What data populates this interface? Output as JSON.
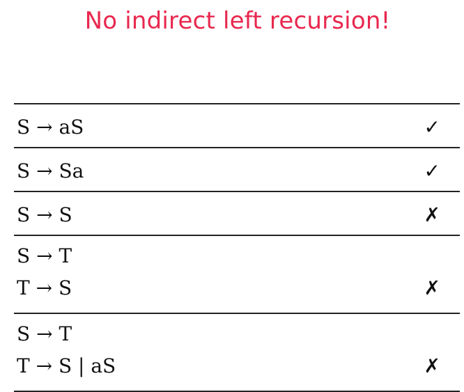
{
  "title": "No indirect left recursion!",
  "rows": [
    {
      "lines": [
        "S → aS"
      ],
      "mark": "✓"
    },
    {
      "lines": [
        "S → Sa"
      ],
      "mark": "✓"
    },
    {
      "lines": [
        "S → S"
      ],
      "mark": "✗"
    },
    {
      "lines": [
        "S → T",
        "T → S"
      ],
      "mark": "✗"
    },
    {
      "lines": [
        "S → T",
        "T → S | aS"
      ],
      "mark": "✗"
    }
  ]
}
